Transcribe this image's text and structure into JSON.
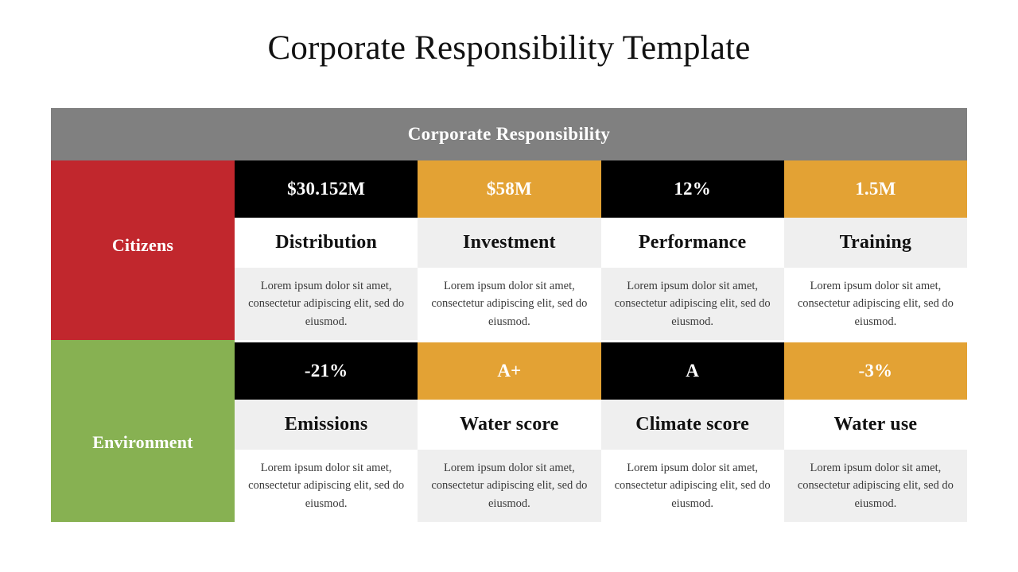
{
  "slide": {
    "title": "Corporate Responsibility Template"
  },
  "table": {
    "header": "Corporate Responsibility",
    "colors": {
      "header_bar": "#808080",
      "citizens": "#c1272d",
      "environment": "#87b152",
      "value_dark": "#000000",
      "value_gold": "#e3a234",
      "tint": "#efefef",
      "white": "#ffffff"
    },
    "rows": [
      {
        "category": "Citizens",
        "category_color": "#c1272d",
        "cells": [
          {
            "value": "$30.152M",
            "value_style": "dark",
            "label": "Distribution",
            "label_bg": "white",
            "description": "Lorem ipsum dolor sit amet, consectetur adipiscing elit, sed do eiusmod.",
            "description_bg": "tint"
          },
          {
            "value": "$58M",
            "value_style": "gold",
            "label": "Investment",
            "label_bg": "tint",
            "description": "Lorem ipsum dolor sit amet, consectetur adipiscing elit, sed do eiusmod.",
            "description_bg": "white"
          },
          {
            "value": "12%",
            "value_style": "dark",
            "label": "Performance",
            "label_bg": "white",
            "description": "Lorem ipsum dolor sit amet, consectetur adipiscing elit, sed do eiusmod.",
            "description_bg": "tint"
          },
          {
            "value": "1.5M",
            "value_style": "gold",
            "label": "Training",
            "label_bg": "tint",
            "description": "Lorem ipsum dolor sit amet, consectetur adipiscing elit, sed do eiusmod.",
            "description_bg": "white"
          }
        ]
      },
      {
        "category": "Environment",
        "category_color": "#87b152",
        "cells": [
          {
            "value": "-21%",
            "value_style": "dark",
            "label": "Emissions",
            "label_bg": "tint",
            "description": "Lorem ipsum dolor sit amet, consectetur adipiscing elit, sed do eiusmod.",
            "description_bg": "white"
          },
          {
            "value": "A+",
            "value_style": "gold",
            "label": "Water score",
            "label_bg": "white",
            "description": "Lorem ipsum dolor sit amet, consectetur adipiscing elit, sed do eiusmod.",
            "description_bg": "tint"
          },
          {
            "value": "A",
            "value_style": "dark",
            "label": "Climate score",
            "label_bg": "tint",
            "description": "Lorem ipsum dolor sit amet, consectetur adipiscing elit, sed do eiusmod.",
            "description_bg": "white"
          },
          {
            "value": "-3%",
            "value_style": "gold",
            "label": "Water use",
            "label_bg": "white",
            "description": "Lorem ipsum dolor sit amet, consectetur adipiscing elit, sed do eiusmod.",
            "description_bg": "tint"
          }
        ]
      }
    ]
  }
}
